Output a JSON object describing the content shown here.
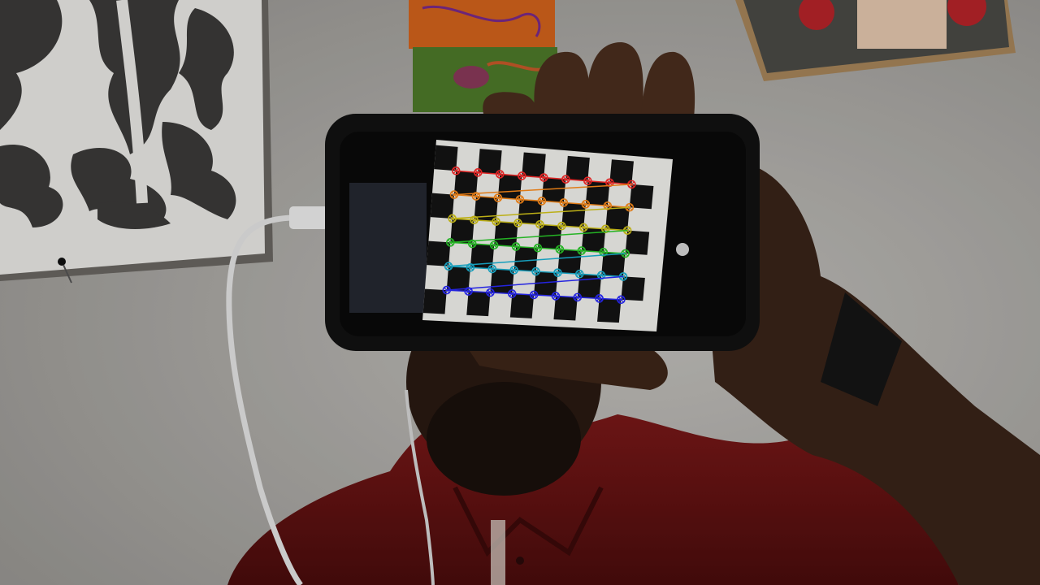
{
  "scene": {
    "subject": "person-holding-phone",
    "colors": {
      "wall": "#b9b7b3",
      "shirt": "#6e1414",
      "skin": "#3a2418",
      "phone_case": "#121212",
      "screen_white": "#f4f4f0",
      "checker_black": "#141414",
      "cable": "#e6e6e6"
    }
  },
  "calibration": {
    "pattern": "checkerboard",
    "corner_rows": 6,
    "corner_cols": 9,
    "row_colors": [
      "#ff2a2a",
      "#ff8c1a",
      "#d6c81a",
      "#2acc2a",
      "#1ab4d6",
      "#2a2aff"
    ]
  }
}
